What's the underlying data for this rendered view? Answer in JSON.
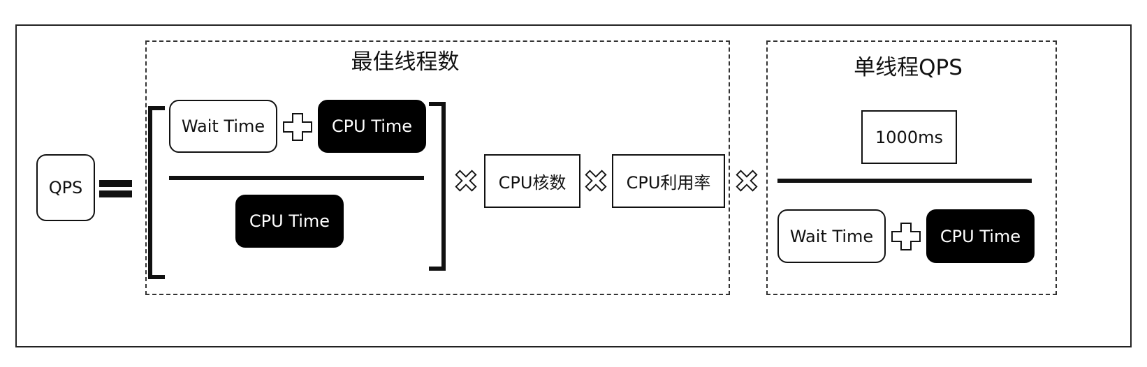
{
  "lhs": {
    "label": "QPS"
  },
  "optimal_threads": {
    "title": "最佳线程数",
    "numerator": {
      "wait": "Wait Time",
      "cpu": "CPU Time"
    },
    "denominator": {
      "cpu": "CPU Time"
    }
  },
  "factors": {
    "cores": "CPU核数",
    "utilization": "CPU利用率"
  },
  "single_thread_qps": {
    "title": "单线程QPS",
    "numerator": "1000ms",
    "denominator": {
      "wait": "Wait Time",
      "cpu": "CPU Time"
    }
  }
}
